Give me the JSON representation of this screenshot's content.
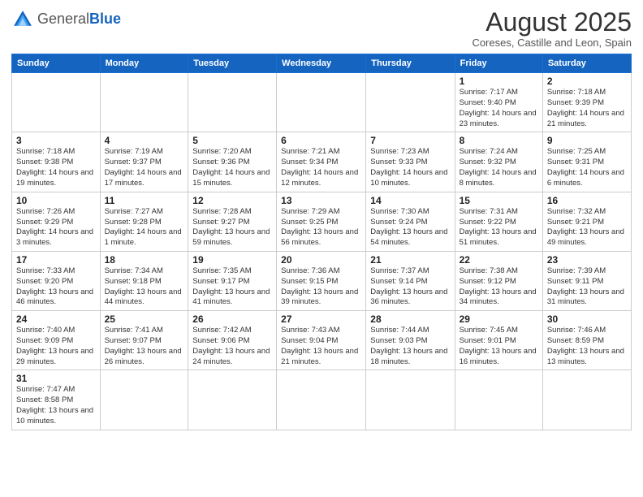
{
  "logo": {
    "general": "General",
    "blue": "Blue"
  },
  "header": {
    "month": "August 2025",
    "location": "Coreses, Castille and Leon, Spain"
  },
  "days_of_week": [
    "Sunday",
    "Monday",
    "Tuesday",
    "Wednesday",
    "Thursday",
    "Friday",
    "Saturday"
  ],
  "weeks": [
    {
      "days": [
        {
          "num": "",
          "info": ""
        },
        {
          "num": "",
          "info": ""
        },
        {
          "num": "",
          "info": ""
        },
        {
          "num": "",
          "info": ""
        },
        {
          "num": "",
          "info": ""
        },
        {
          "num": "1",
          "info": "Sunrise: 7:17 AM\nSunset: 9:40 PM\nDaylight: 14 hours and 23 minutes."
        },
        {
          "num": "2",
          "info": "Sunrise: 7:18 AM\nSunset: 9:39 PM\nDaylight: 14 hours and 21 minutes."
        }
      ]
    },
    {
      "days": [
        {
          "num": "3",
          "info": "Sunrise: 7:18 AM\nSunset: 9:38 PM\nDaylight: 14 hours and 19 minutes."
        },
        {
          "num": "4",
          "info": "Sunrise: 7:19 AM\nSunset: 9:37 PM\nDaylight: 14 hours and 17 minutes."
        },
        {
          "num": "5",
          "info": "Sunrise: 7:20 AM\nSunset: 9:36 PM\nDaylight: 14 hours and 15 minutes."
        },
        {
          "num": "6",
          "info": "Sunrise: 7:21 AM\nSunset: 9:34 PM\nDaylight: 14 hours and 12 minutes."
        },
        {
          "num": "7",
          "info": "Sunrise: 7:23 AM\nSunset: 9:33 PM\nDaylight: 14 hours and 10 minutes."
        },
        {
          "num": "8",
          "info": "Sunrise: 7:24 AM\nSunset: 9:32 PM\nDaylight: 14 hours and 8 minutes."
        },
        {
          "num": "9",
          "info": "Sunrise: 7:25 AM\nSunset: 9:31 PM\nDaylight: 14 hours and 6 minutes."
        }
      ]
    },
    {
      "days": [
        {
          "num": "10",
          "info": "Sunrise: 7:26 AM\nSunset: 9:29 PM\nDaylight: 14 hours and 3 minutes."
        },
        {
          "num": "11",
          "info": "Sunrise: 7:27 AM\nSunset: 9:28 PM\nDaylight: 14 hours and 1 minute."
        },
        {
          "num": "12",
          "info": "Sunrise: 7:28 AM\nSunset: 9:27 PM\nDaylight: 13 hours and 59 minutes."
        },
        {
          "num": "13",
          "info": "Sunrise: 7:29 AM\nSunset: 9:25 PM\nDaylight: 13 hours and 56 minutes."
        },
        {
          "num": "14",
          "info": "Sunrise: 7:30 AM\nSunset: 9:24 PM\nDaylight: 13 hours and 54 minutes."
        },
        {
          "num": "15",
          "info": "Sunrise: 7:31 AM\nSunset: 9:22 PM\nDaylight: 13 hours and 51 minutes."
        },
        {
          "num": "16",
          "info": "Sunrise: 7:32 AM\nSunset: 9:21 PM\nDaylight: 13 hours and 49 minutes."
        }
      ]
    },
    {
      "days": [
        {
          "num": "17",
          "info": "Sunrise: 7:33 AM\nSunset: 9:20 PM\nDaylight: 13 hours and 46 minutes."
        },
        {
          "num": "18",
          "info": "Sunrise: 7:34 AM\nSunset: 9:18 PM\nDaylight: 13 hours and 44 minutes."
        },
        {
          "num": "19",
          "info": "Sunrise: 7:35 AM\nSunset: 9:17 PM\nDaylight: 13 hours and 41 minutes."
        },
        {
          "num": "20",
          "info": "Sunrise: 7:36 AM\nSunset: 9:15 PM\nDaylight: 13 hours and 39 minutes."
        },
        {
          "num": "21",
          "info": "Sunrise: 7:37 AM\nSunset: 9:14 PM\nDaylight: 13 hours and 36 minutes."
        },
        {
          "num": "22",
          "info": "Sunrise: 7:38 AM\nSunset: 9:12 PM\nDaylight: 13 hours and 34 minutes."
        },
        {
          "num": "23",
          "info": "Sunrise: 7:39 AM\nSunset: 9:11 PM\nDaylight: 13 hours and 31 minutes."
        }
      ]
    },
    {
      "days": [
        {
          "num": "24",
          "info": "Sunrise: 7:40 AM\nSunset: 9:09 PM\nDaylight: 13 hours and 29 minutes."
        },
        {
          "num": "25",
          "info": "Sunrise: 7:41 AM\nSunset: 9:07 PM\nDaylight: 13 hours and 26 minutes."
        },
        {
          "num": "26",
          "info": "Sunrise: 7:42 AM\nSunset: 9:06 PM\nDaylight: 13 hours and 24 minutes."
        },
        {
          "num": "27",
          "info": "Sunrise: 7:43 AM\nSunset: 9:04 PM\nDaylight: 13 hours and 21 minutes."
        },
        {
          "num": "28",
          "info": "Sunrise: 7:44 AM\nSunset: 9:03 PM\nDaylight: 13 hours and 18 minutes."
        },
        {
          "num": "29",
          "info": "Sunrise: 7:45 AM\nSunset: 9:01 PM\nDaylight: 13 hours and 16 minutes."
        },
        {
          "num": "30",
          "info": "Sunrise: 7:46 AM\nSunset: 8:59 PM\nDaylight: 13 hours and 13 minutes."
        }
      ]
    },
    {
      "days": [
        {
          "num": "31",
          "info": "Sunrise: 7:47 AM\nSunset: 8:58 PM\nDaylight: 13 hours and 10 minutes."
        },
        {
          "num": "",
          "info": ""
        },
        {
          "num": "",
          "info": ""
        },
        {
          "num": "",
          "info": ""
        },
        {
          "num": "",
          "info": ""
        },
        {
          "num": "",
          "info": ""
        },
        {
          "num": "",
          "info": ""
        }
      ]
    }
  ]
}
